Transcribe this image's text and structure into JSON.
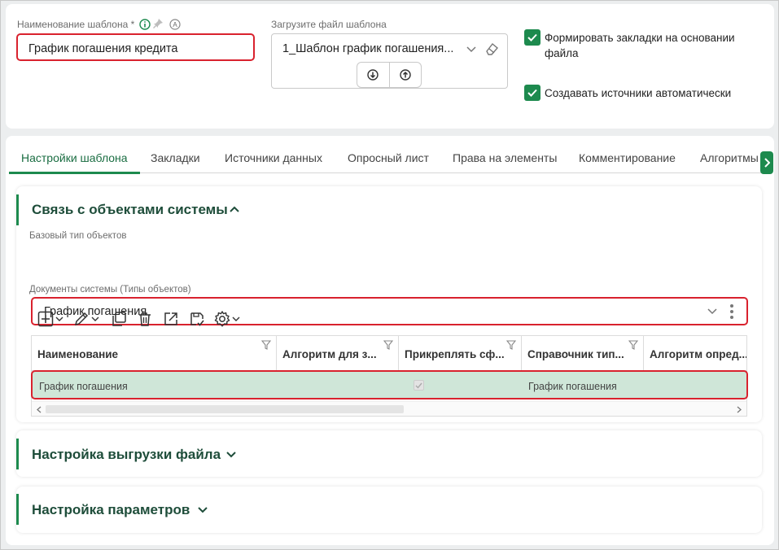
{
  "template": {
    "name_label": "Наименование шаблона *",
    "name_value": "График погашения кредита",
    "file_label": "Загрузите файл шаблона",
    "file_value": "1_Шаблон график погашения...",
    "checkbox_bookmarks": "Формировать закладки на основании файла",
    "checkbox_sources": "Создавать источники автоматически"
  },
  "tabs": [
    "Настройки шаблона",
    "Закладки",
    "Источники данных",
    "Опросный лист",
    "Права на элементы",
    "Комментирование",
    "Алгоритмы"
  ],
  "section_link": {
    "title": "Связь с объектами системы",
    "base_type_label": "Базовый тип объектов",
    "base_type_value": "График погашения",
    "docs_label": "Документы системы (Типы объектов)",
    "columns": [
      "Наименование",
      "Алгоритм для з...",
      "Прикреплять сф...",
      "Справочник тип...",
      "Алгоритм опред..."
    ],
    "rows": [
      {
        "name": "График погашения",
        "algo": "",
        "attach": true,
        "directory": "График погашения",
        "algo_def": ""
      }
    ]
  },
  "section_export": {
    "title": "Настройка выгрузки файла"
  },
  "section_params": {
    "title": "Настройка параметров"
  },
  "colors": {
    "accent": "#1d8a4e",
    "highlight": "#d9222e",
    "selected_row": "#cfe6d8"
  }
}
